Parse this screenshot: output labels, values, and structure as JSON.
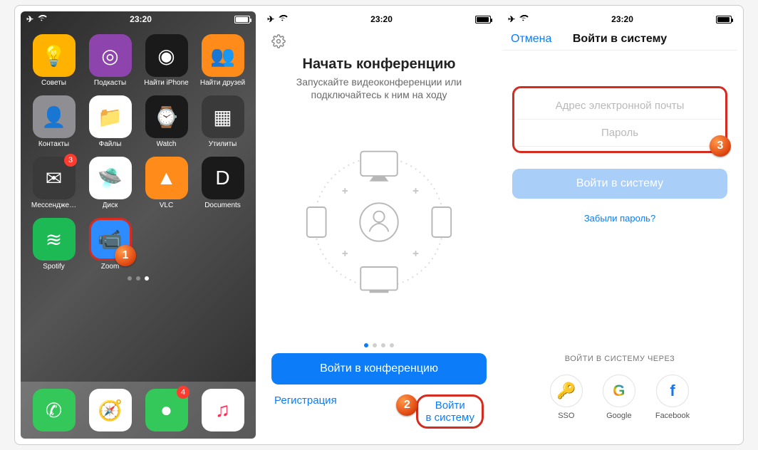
{
  "statusbar": {
    "time": "23:20"
  },
  "home": {
    "apps": [
      {
        "label": "Советы",
        "bg": "#ffb300",
        "glyph": "💡"
      },
      {
        "label": "Подкасты",
        "bg": "#8e44ad",
        "glyph": "◎"
      },
      {
        "label": "Найти iPhone",
        "bg": "#1a1a1a",
        "glyph": "◉"
      },
      {
        "label": "Найти друзей",
        "bg": "#ff8c1a",
        "glyph": "👥"
      },
      {
        "label": "Контакты",
        "bg": "#8e8e93",
        "glyph": "👤"
      },
      {
        "label": "Файлы",
        "bg": "#ffffff",
        "glyph": "📁"
      },
      {
        "label": "Watch",
        "bg": "#1a1a1a",
        "glyph": "⌚"
      },
      {
        "label": "Утилиты",
        "bg": "#3a3a3a",
        "glyph": "▦"
      },
      {
        "label": "Мессендже…",
        "bg": "#3a3a3a",
        "glyph": "✉",
        "badge": "3"
      },
      {
        "label": "Диск",
        "bg": "#ffffff",
        "glyph": "🛸"
      },
      {
        "label": "VLC",
        "bg": "#ff8c1a",
        "glyph": "▲"
      },
      {
        "label": "Documents",
        "bg": "#1a1a1a",
        "glyph": "D"
      },
      {
        "label": "Spotify",
        "bg": "#1db954",
        "glyph": "≋"
      },
      {
        "label": "Zoom",
        "bg": "#2d8cff",
        "glyph": "📹",
        "highlight": true
      }
    ],
    "dock": [
      {
        "name": "phone",
        "bg": "#34c759",
        "glyph": "✆"
      },
      {
        "name": "safari",
        "bg": "#ffffff",
        "glyph": "🧭"
      },
      {
        "name": "messages",
        "bg": "#34c759",
        "glyph": "●",
        "badge": "4"
      },
      {
        "name": "music",
        "bg": "#ffffff",
        "glyph": "♫"
      }
    ]
  },
  "onboarding": {
    "title": "Начать конференцию",
    "subtitle": "Запускайте видеоконференции или подключайтесь к ним на ходу",
    "join_button": "Войти в конференцию",
    "register": "Регистрация",
    "signin": "Войти\nв систему"
  },
  "login": {
    "cancel": "Отмена",
    "title": "Войти в систему",
    "email_placeholder": "Адрес электронной почты",
    "password_placeholder": "Пароль",
    "button": "Войти в систему",
    "forgot": "Забыли пароль?",
    "via_label": "ВОЙТИ В СИСТЕМУ ЧЕРЕЗ",
    "socials": [
      {
        "name": "SSO",
        "label": "SSO",
        "glyph": "🔑",
        "color": "#444"
      },
      {
        "name": "Google",
        "label": "Google",
        "glyph": "G",
        "color": "#000"
      },
      {
        "name": "Facebook",
        "label": "Facebook",
        "glyph": "f",
        "color": "#1877f2"
      }
    ]
  },
  "steps": {
    "one": "1",
    "two": "2",
    "three": "3"
  }
}
